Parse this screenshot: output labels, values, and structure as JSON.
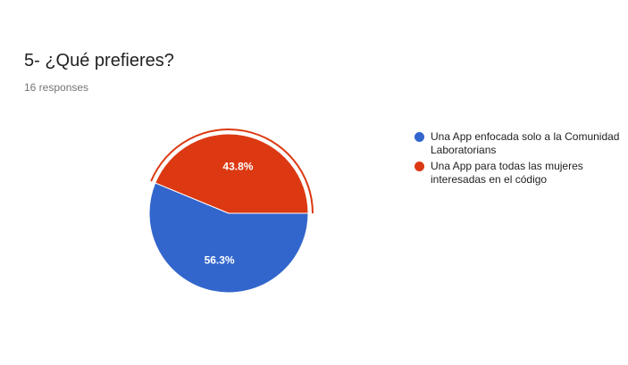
{
  "header": {
    "title": "5- ¿Qué prefieres?",
    "responses": "16 responses"
  },
  "chart_data": {
    "type": "pie",
    "categories": [
      "Una App enfocada solo a la Comunidad Laboratorians",
      "Una App para todas las mujeres interesadas en el código"
    ],
    "values": [
      56.3,
      43.8
    ],
    "labels": [
      "56.3%",
      "43.8%"
    ],
    "colors": [
      "#3366cc",
      "#dc3912"
    ],
    "highlighted_index": 1,
    "legend_position": "right"
  }
}
